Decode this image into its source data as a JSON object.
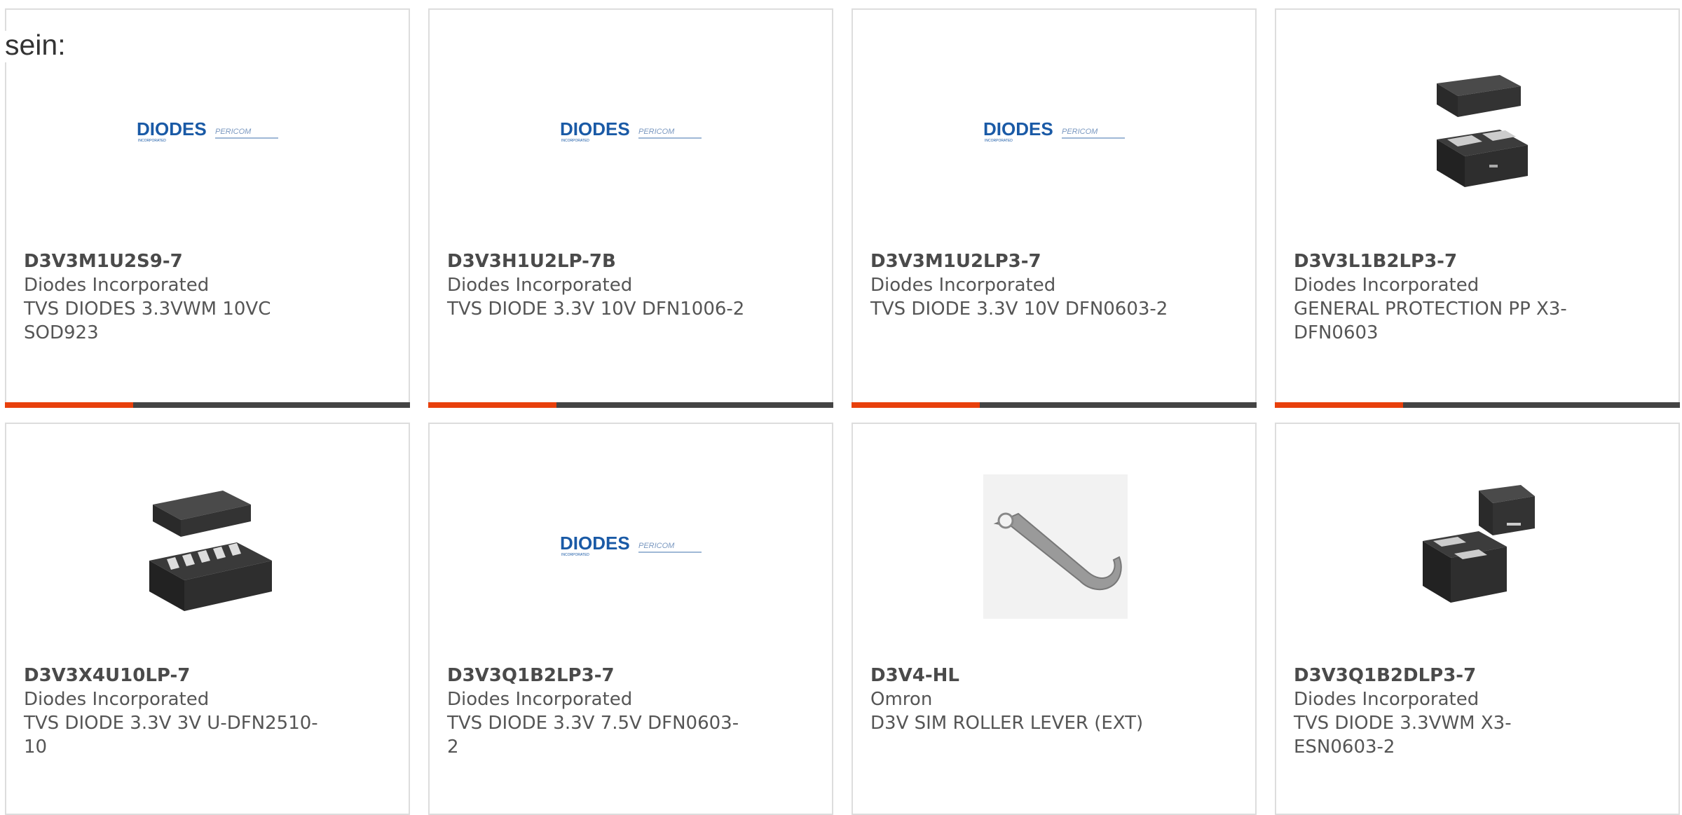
{
  "intro": "sein:",
  "colors": {
    "accent": "#e8400c",
    "bar": "#444444",
    "border": "#dddddd",
    "brand_blue": "#1a5aa6"
  },
  "products": [
    {
      "part_number": "D3V3M1U2S9-7",
      "manufacturer": "Diodes Incorporated",
      "description": "TVS DIODES 3.3VWM 10VC SOD923",
      "image": "diodes-pericom-logo",
      "logo_brand": "DIODES",
      "logo_sub": "INCORPORATED",
      "logo_brand2": "PERICOM"
    },
    {
      "part_number": "D3V3H1U2LP-7B",
      "manufacturer": "Diodes Incorporated",
      "description": "TVS DIODE 3.3V 10V DFN1006-2",
      "image": "diodes-pericom-logo",
      "logo_brand": "DIODES",
      "logo_sub": "INCORPORATED",
      "logo_brand2": "PERICOM"
    },
    {
      "part_number": "D3V3M1U2LP3-7",
      "manufacturer": "Diodes Incorporated",
      "description": "TVS DIODE 3.3V 10V DFN0603-2",
      "image": "diodes-pericom-logo",
      "logo_brand": "DIODES",
      "logo_sub": "INCORPORATED",
      "logo_brand2": "PERICOM"
    },
    {
      "part_number": "D3V3L1B2LP3-7",
      "manufacturer": "Diodes Incorporated",
      "description": "GENERAL PROTECTION PP X3-DFN0603",
      "image": "dfn-package-photo"
    },
    {
      "part_number": "D3V3X4U10LP-7",
      "manufacturer": "Diodes Incorporated",
      "description": "TVS DIODE 3.3V 3V U-DFN2510-10",
      "image": "udfn-package-photo"
    },
    {
      "part_number": "D3V3Q1B2LP3-7",
      "manufacturer": "Diodes Incorporated",
      "description": "TVS DIODE 3.3V 7.5V DFN0603-2",
      "image": "diodes-pericom-logo",
      "logo_brand": "DIODES",
      "logo_sub": "INCORPORATED",
      "logo_brand2": "PERICOM"
    },
    {
      "part_number": "D3V4-HL",
      "manufacturer": "Omron",
      "description": "D3V SIM ROLLER LEVER (EXT)",
      "image": "roller-lever-photo"
    },
    {
      "part_number": "D3V3Q1B2DLP3-7",
      "manufacturer": "Diodes Incorporated",
      "description": "TVS DIODE 3.3VWM X3-ESN0603-2",
      "image": "esn-package-photo"
    }
  ]
}
